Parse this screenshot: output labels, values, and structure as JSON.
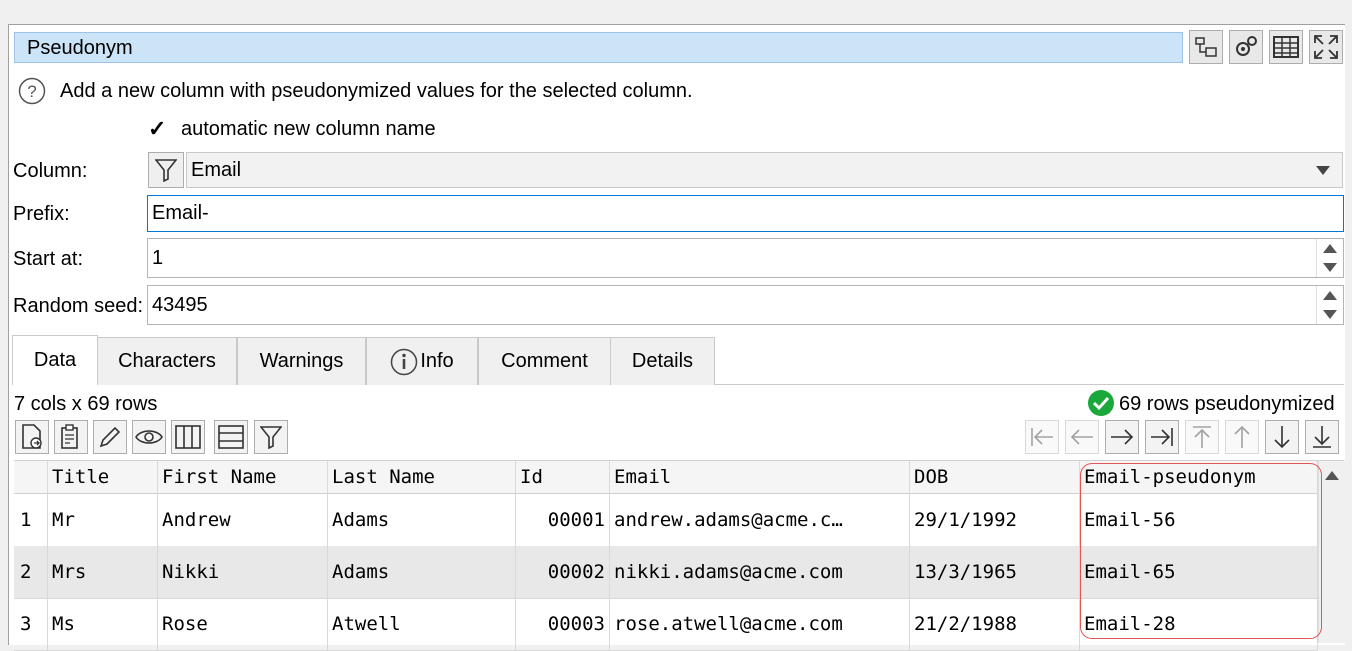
{
  "header": {
    "title": "Pseudonym"
  },
  "description": "Add a new column with pseudonymized values for the selected column.",
  "options": {
    "auto_name_label": "automatic new column name",
    "auto_name_checked": "✓"
  },
  "form": {
    "column_label": "Column:",
    "column_value": "Email",
    "prefix_label": "Prefix:",
    "prefix_value": "Email-",
    "start_label": "Start at:",
    "start_value": "1",
    "seed_label": "Random seed:",
    "seed_value": "43495"
  },
  "tabs": [
    "Data",
    "Characters",
    "Warnings",
    "Info",
    "Comment",
    "Details"
  ],
  "status": {
    "dims": "7 cols x 69 rows",
    "result": "69 rows pseudonymized"
  },
  "table": {
    "headers": [
      "Title",
      "First Name",
      "Last Name",
      "Id",
      "Email",
      "DOB",
      "Email-pseudonym"
    ],
    "rows": [
      {
        "n": "1",
        "cells": [
          "Mr",
          "Andrew",
          "Adams",
          "00001",
          "andrew.adams@acme.c…",
          "29/1/1992",
          "Email-56"
        ]
      },
      {
        "n": "2",
        "cells": [
          "Mrs",
          "Nikki",
          "Adams",
          "00002",
          "nikki.adams@acme.com",
          "13/3/1965",
          "Email-65"
        ]
      },
      {
        "n": "3",
        "cells": [
          "Ms",
          "Rose",
          "Atwell",
          "00003",
          "rose.atwell@acme.com",
          "21/2/1988",
          "Email-28"
        ]
      }
    ]
  },
  "colors": {
    "title_bg": "#cce4f7",
    "focus": "#0078d7",
    "success": "#1aa83a",
    "highlight": "#e05555"
  }
}
